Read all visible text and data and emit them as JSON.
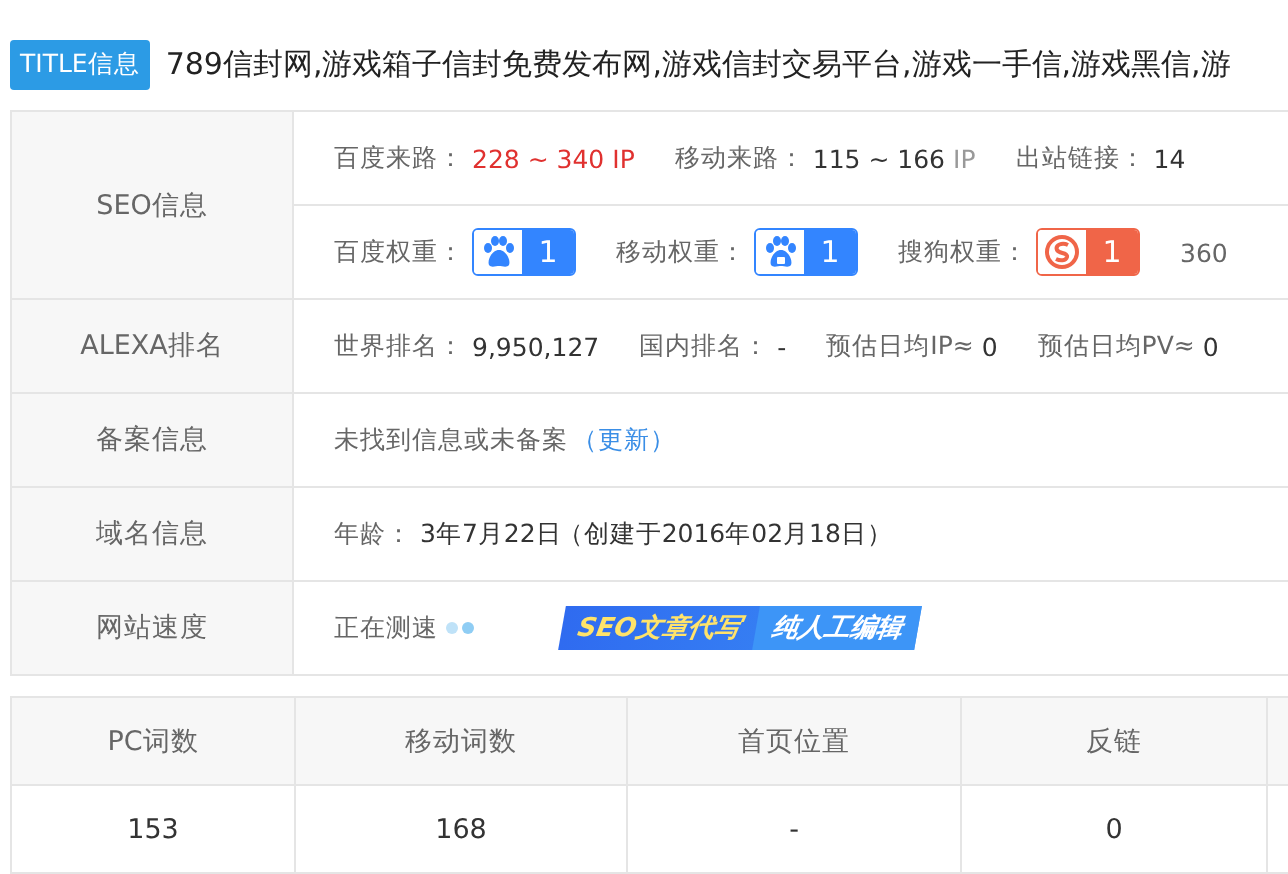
{
  "title": {
    "badge": "TITLE信息",
    "text": "789信封网,游戏箱子信封免费发布网,游戏信封交易平台,游戏一手信,游戏黑信,游"
  },
  "info_rows": [
    {
      "label": "SEO信息",
      "lines": [
        [
          {
            "kind": "stat",
            "label": "百度来路：",
            "value": "228 ~ 340",
            "unit": "IP",
            "highlight": true
          },
          {
            "kind": "stat",
            "label": "移动来路：",
            "value": "115 ~ 166",
            "unit": "IP"
          },
          {
            "kind": "stat",
            "label": "出站链接：",
            "value": "14"
          }
        ],
        [
          {
            "kind": "weight_paw",
            "label": "百度权重：",
            "value": "1"
          },
          {
            "kind": "weight_paw_mobile",
            "label": "移动权重：",
            "value": "1"
          },
          {
            "kind": "weight_circle",
            "label": "搜狗权重：",
            "value": "1"
          },
          {
            "kind": "stat",
            "label": "360"
          }
        ]
      ]
    },
    {
      "label": "ALEXA排名",
      "lines": [
        [
          {
            "kind": "stat",
            "label": "世界排名：",
            "value": "9,950,127"
          },
          {
            "kind": "stat",
            "label": "国内排名：",
            "value": "-"
          },
          {
            "kind": "stat",
            "label": "预估日均IP≈",
            "value": "0"
          },
          {
            "kind": "stat",
            "label": "预估日均PV≈",
            "value": "0"
          }
        ]
      ]
    },
    {
      "label": "备案信息",
      "lines": [
        [
          {
            "kind": "stat",
            "label": "未找到信息或未备案"
          },
          {
            "kind": "link",
            "text": "（更新）"
          }
        ]
      ]
    },
    {
      "label": "域名信息",
      "lines": [
        [
          {
            "kind": "stat",
            "label": "年龄：",
            "value": "3年7月22日"
          },
          {
            "kind": "note",
            "text": "（创建于2016年02月18日）"
          }
        ]
      ]
    },
    {
      "label": "网站速度",
      "lines": [
        [
          {
            "kind": "loading",
            "text": "正在测速"
          },
          {
            "kind": "ad",
            "parts": [
              "SEO文章代写",
              "纯人工编辑"
            ]
          }
        ]
      ]
    }
  ],
  "keywords": {
    "columns": [
      "PC词数",
      "移动词数",
      "首页位置",
      "反链"
    ],
    "rows": [
      [
        "153",
        "168",
        "-",
        "0"
      ]
    ]
  }
}
